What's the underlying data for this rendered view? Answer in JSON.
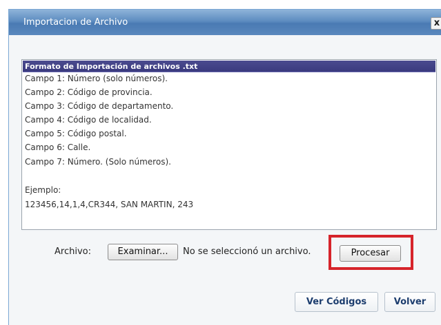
{
  "dialog": {
    "title": "Importacion de Archivo",
    "close_label": "x"
  },
  "info": {
    "header": "Formato de Importación de archivos .txt",
    "lines": [
      "Campo 1: Número (solo números).",
      "Campo 2: Código de provincia.",
      "Campo 3: Código de departamento.",
      "Campo 4: Código de localidad.",
      "Campo 5: Código postal.",
      "Campo 6: Calle.",
      "Campo 7: Número. (Solo números)."
    ],
    "example_label": "Ejemplo:",
    "example_value": "123456,14,1,4,CR344, SAN MARTIN, 243"
  },
  "form": {
    "file_label": "Archivo:",
    "browse_label": "Examinar...",
    "no_file_text": "No se seleccionó un archivo.",
    "process_label": "Procesar"
  },
  "footer": {
    "view_codes_label": "Ver Códigos",
    "back_label": "Volver"
  },
  "colors": {
    "title_bar": "#4a7ab3",
    "info_header": "#3a3a7e",
    "highlight": "#d6242b",
    "footer_text": "#1c3d6e"
  }
}
